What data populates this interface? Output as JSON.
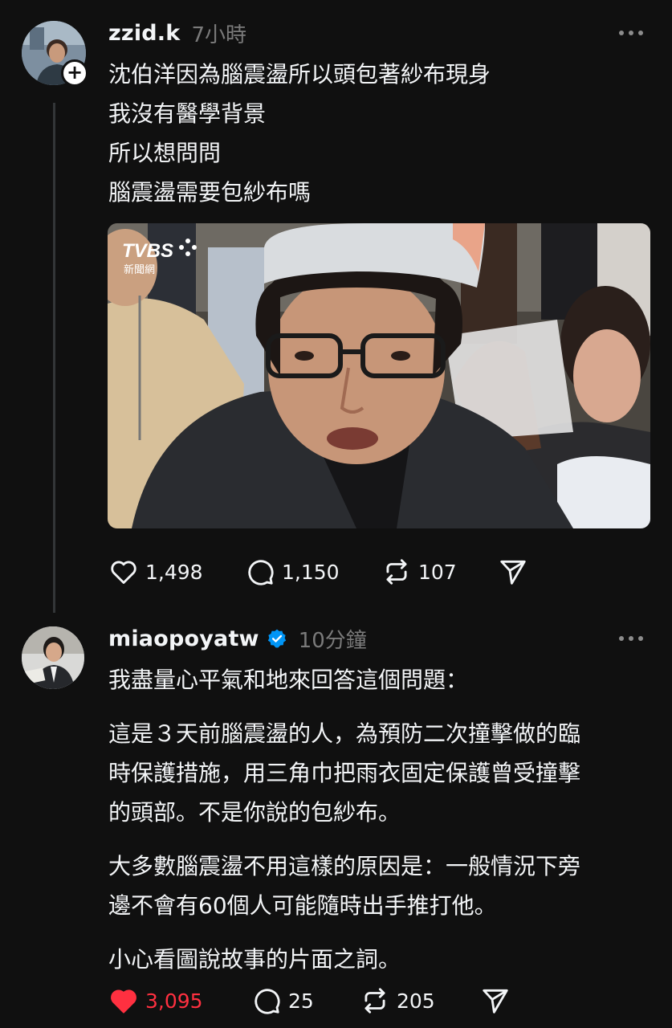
{
  "posts": [
    {
      "username": "zzid.k",
      "time": "7小時",
      "lines": [
        "沈伯洋因為腦震盪所以頭包著紗布現身",
        "我沒有醫學背景",
        "所以想問問",
        "腦震盪需要包紗布嗎"
      ],
      "image": {
        "watermark": "TVBS",
        "watermark_sub": "新聞網"
      },
      "likes": "1,498",
      "replies": "1,150",
      "reposts": "107"
    },
    {
      "username": "miaopoyatw",
      "verified": true,
      "time": "10分鐘",
      "paragraphs": [
        [
          "我盡量心平氣和地來回答這個問題："
        ],
        [
          "這是３天前腦震盪的人，為預防二次撞擊做的臨",
          "時保護措施，用三角巾把雨衣固定保護曾受撞擊",
          "的頭部。不是你說的包紗布。"
        ],
        [
          "大多數腦震盪不用這樣的原因是：一般情況下旁",
          "邊不會有60個人可能隨時出手推打他。"
        ],
        [
          "小心看圖說故事的片面之詞。"
        ]
      ],
      "likes": "3,095",
      "liked": true,
      "replies": "25",
      "reposts": "205"
    }
  ],
  "icons": {
    "like": "heart-icon",
    "reply": "comment-icon",
    "repost": "repost-icon",
    "share": "send-icon",
    "more": "more-options-icon",
    "verified": "verified-badge-icon",
    "follow": "plus-icon"
  },
  "colors": {
    "background": "#101010",
    "text": "#f3f5f7",
    "muted": "#7a7a7a",
    "like_active": "#ff3040",
    "verified": "#0095f6"
  }
}
